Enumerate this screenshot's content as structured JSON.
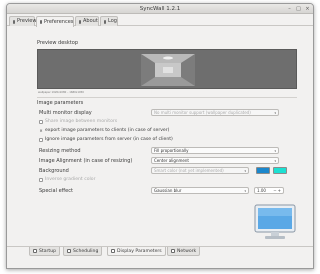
{
  "window": {
    "title": "SyncWall 1.2.1",
    "controls": [
      "–",
      "□",
      "×"
    ]
  },
  "top_tabs": [
    {
      "label": "Preview",
      "icon": "preview-icon"
    },
    {
      "label": "Preferences",
      "icon": "preferences-icon",
      "active": true
    },
    {
      "label": "About",
      "icon": "about-icon"
    },
    {
      "label": "Log",
      "icon": "log-icon"
    }
  ],
  "preview": {
    "heading": "Preview desktop",
    "caption": "wallpaper 1920x1080 – 1680x1050"
  },
  "params": {
    "heading": "Image parameters",
    "multi_monitor": {
      "label": "Multi monitor display",
      "value": "No multi monitor support (wallpaper duplicated)"
    },
    "share_between_monitors": "Share image between monitors",
    "export_params": "export image parameters to clients (in case of server)",
    "ignore_params": "Ignore image parameters from server (in case of client)",
    "resizing": {
      "label": "Resizing method",
      "value": "Fill proportionally"
    },
    "alignment": {
      "label": "Image Alignment (in case of resizing)",
      "value": "Center alignment"
    },
    "background": {
      "label": "Background",
      "value": "Smart color (not yet implemented)"
    },
    "inverse_gradient": "Inverse gradient color",
    "special_effect": {
      "label": "Special effect",
      "value": "Gaussian blur",
      "amount": "1.00"
    }
  },
  "colors": {
    "background_swatch_1": "#1b87cc",
    "background_swatch_2": "#1ce0d2"
  },
  "bottom_tabs": [
    {
      "label": "Startup",
      "icon": "startup-icon"
    },
    {
      "label": "Scheduling",
      "icon": "scheduling-icon"
    },
    {
      "label": "Display Parameters",
      "icon": "display-icon",
      "active": true
    },
    {
      "label": "Network",
      "icon": "network-icon"
    }
  ]
}
